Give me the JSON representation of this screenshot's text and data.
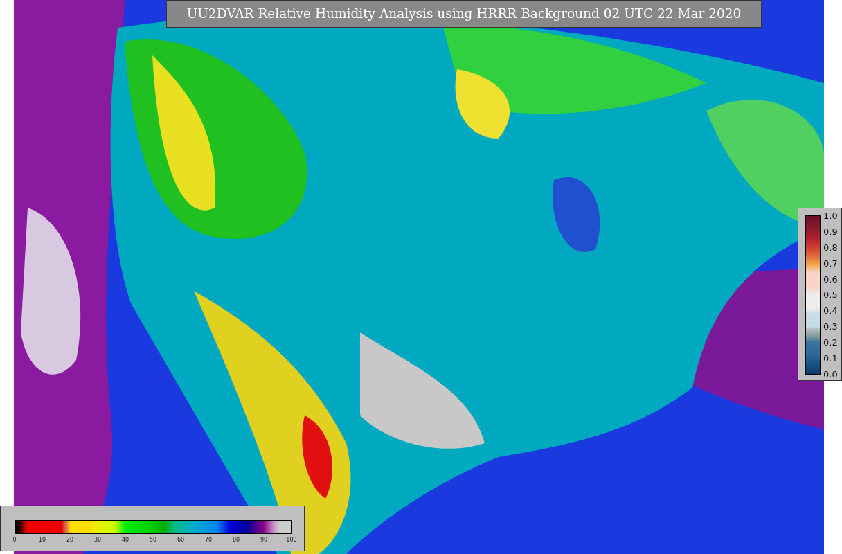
{
  "title": "UU2DVAR Relative Humidity Analysis using HRRR Background 02 UTC 22 Mar 2020",
  "humidity_colorbar": {
    "ticks": [
      "0",
      "10",
      "20",
      "30",
      "40",
      "50",
      "60",
      "70",
      "80",
      "90",
      "100"
    ]
  },
  "observation_colorbar": {
    "ticks": [
      "1.0",
      "0.9",
      "0.8",
      "0.7",
      "0.6",
      "0.5",
      "0.4",
      "0.3",
      "0.2",
      "0.1",
      "0.0"
    ]
  }
}
